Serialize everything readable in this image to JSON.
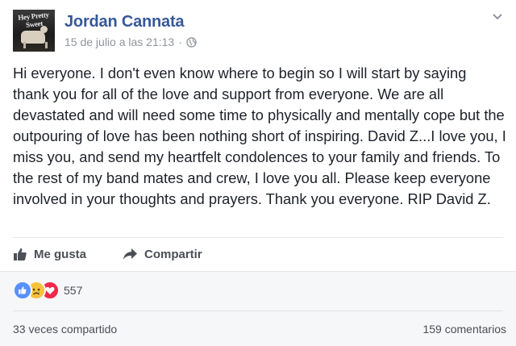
{
  "author": {
    "name": "Jordan Cannata",
    "avatar_logo_text": "Hey Pretty Sweet"
  },
  "meta": {
    "timestamp": "15 de julio a las 21:13",
    "separator": "·",
    "audience_icon": "globe-icon"
  },
  "menu_icon": "chevron-down-icon",
  "post": {
    "text": "Hi everyone. I don't even know where to begin so I will start by saying thank you for all of the love and support from everyone. We are all devastated and will need some time to physically and mentally cope but the outpouring of love has been nothing short of inspiring. David Z...I love you, I miss you, and send my heartfelt condolences to your family and friends. To the rest of my band mates and crew, I love you all. Please keep everyone involved in your thoughts and prayers. Thank you everyone. RIP David Z."
  },
  "actions": {
    "like_label": "Me gusta",
    "share_label": "Compartir"
  },
  "reactions": {
    "icons": [
      "like-reaction-icon",
      "sad-reaction-icon",
      "love-reaction-icon"
    ],
    "count": "557"
  },
  "footer": {
    "shares": "33 veces compartido",
    "comments": "159 comentarios"
  },
  "colors": {
    "link": "#365899",
    "muted": "#90949c",
    "like_blue": "#5890ff",
    "sad_yellow": "#f7c23b",
    "love_red": "#f0284a"
  }
}
